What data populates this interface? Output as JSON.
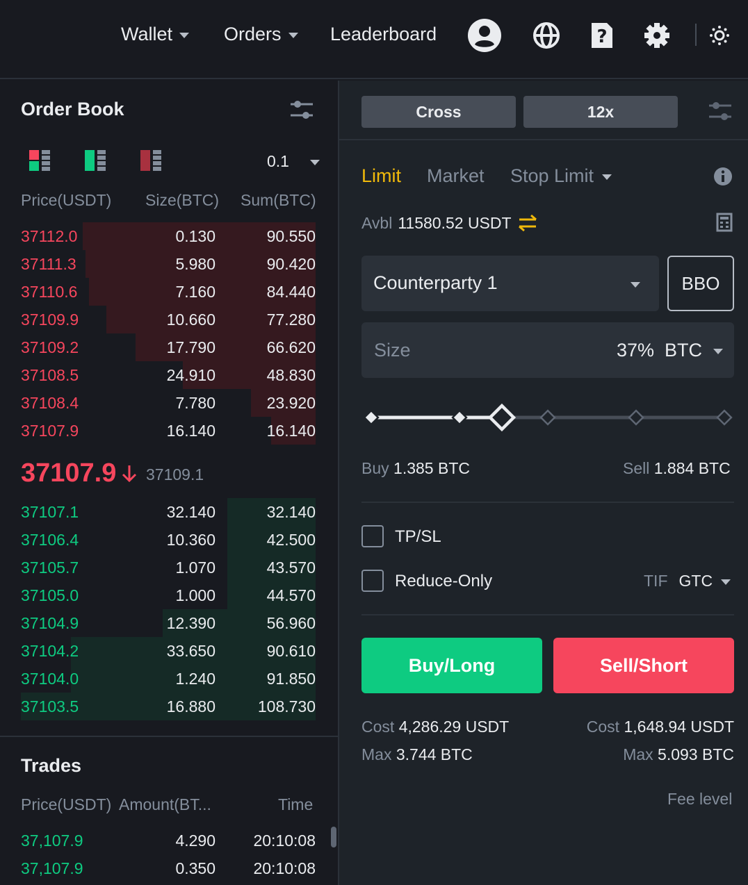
{
  "topbar": {
    "nav": [
      {
        "label": "Wallet",
        "has_caret": true
      },
      {
        "label": "Orders",
        "has_caret": true
      },
      {
        "label": "Leaderboard",
        "has_caret": false
      }
    ],
    "icons": [
      "user-avatar-icon",
      "globe-icon",
      "help-document-icon",
      "gear-icon",
      "theme-toggle-icon"
    ]
  },
  "order_book": {
    "title": "Order Book",
    "precision": "0.1",
    "columns": [
      "Price(USDT)",
      "Size(BTC)",
      "Sum(BTC)"
    ],
    "asks": [
      {
        "price": "37112.0",
        "size": "0.130",
        "sum": "90.550",
        "depth": 0.79
      },
      {
        "price": "37111.3",
        "size": "5.980",
        "sum": "90.420",
        "depth": 0.78
      },
      {
        "price": "37110.6",
        "size": "7.160",
        "sum": "84.440",
        "depth": 0.77
      },
      {
        "price": "37109.9",
        "size": "10.660",
        "sum": "77.280",
        "depth": 0.71
      },
      {
        "price": "37109.2",
        "size": "17.790",
        "sum": "66.620",
        "depth": 0.61
      },
      {
        "price": "37108.5",
        "size": "24.910",
        "sum": "48.830",
        "depth": 0.45
      },
      {
        "price": "37108.4",
        "size": "7.780",
        "sum": "23.920",
        "depth": 0.22
      },
      {
        "price": "37107.9",
        "size": "16.140",
        "sum": "16.140",
        "depth": 0.15
      }
    ],
    "last_price": "37107.9",
    "mark_price": "37109.1",
    "bids": [
      {
        "price": "37107.1",
        "size": "32.140",
        "sum": "32.140",
        "depth": 0.3
      },
      {
        "price": "37106.4",
        "size": "10.360",
        "sum": "42.500",
        "depth": 0.3
      },
      {
        "price": "37105.7",
        "size": "1.070",
        "sum": "43.570",
        "depth": 0.3
      },
      {
        "price": "37105.0",
        "size": "1.000",
        "sum": "44.570",
        "depth": 0.3
      },
      {
        "price": "37104.9",
        "size": "12.390",
        "sum": "56.960",
        "depth": 0.52
      },
      {
        "price": "37104.2",
        "size": "33.650",
        "sum": "90.610",
        "depth": 0.83
      },
      {
        "price": "37104.0",
        "size": "1.240",
        "sum": "91.850",
        "depth": 0.83
      },
      {
        "price": "37103.5",
        "size": "16.880",
        "sum": "108.730",
        "depth": 1.0
      }
    ]
  },
  "trades": {
    "title": "Trades",
    "columns": [
      "Price(USDT)",
      "Amount(BT...",
      "Time"
    ],
    "rows": [
      {
        "price": "37,107.9",
        "amount": "4.290",
        "time": "20:10:08"
      },
      {
        "price": "37,107.9",
        "amount": "0.350",
        "time": "20:10:08"
      }
    ]
  },
  "order_form": {
    "margin_mode": "Cross",
    "leverage": "12x",
    "tabs": [
      "Limit",
      "Market",
      "Stop Limit"
    ],
    "active_tab": "Limit",
    "avbl_label": "Avbl",
    "avbl_value": "11580.52 USDT",
    "counterparty": "Counterparty 1",
    "bbo_label": "BBO",
    "size_placeholder": "Size",
    "size_percent": "37%",
    "size_unit": "BTC",
    "slider_percent": 37,
    "buy_label": "Buy",
    "buy_value": "1.385 BTC",
    "sell_label": "Sell",
    "sell_value": "1.884 BTC",
    "tpsl_label": "TP/SL",
    "reduce_only_label": "Reduce-Only",
    "tif_label": "TIF",
    "tif_value": "GTC",
    "buy_button": "Buy/Long",
    "sell_button": "Sell/Short",
    "cost_label": "Cost",
    "max_label": "Max",
    "buy_cost": "4,286.29 USDT",
    "buy_max": "3.744 BTC",
    "sell_cost": "1,648.94 USDT",
    "sell_max": "5.093 BTC",
    "fee_level": "Fee level"
  },
  "colors": {
    "background": "#181a20",
    "panel": "#1e2329",
    "accent": "#f0b90b",
    "buy": "#0ecb81",
    "sell": "#f6465d",
    "muted": "#848e9c"
  }
}
